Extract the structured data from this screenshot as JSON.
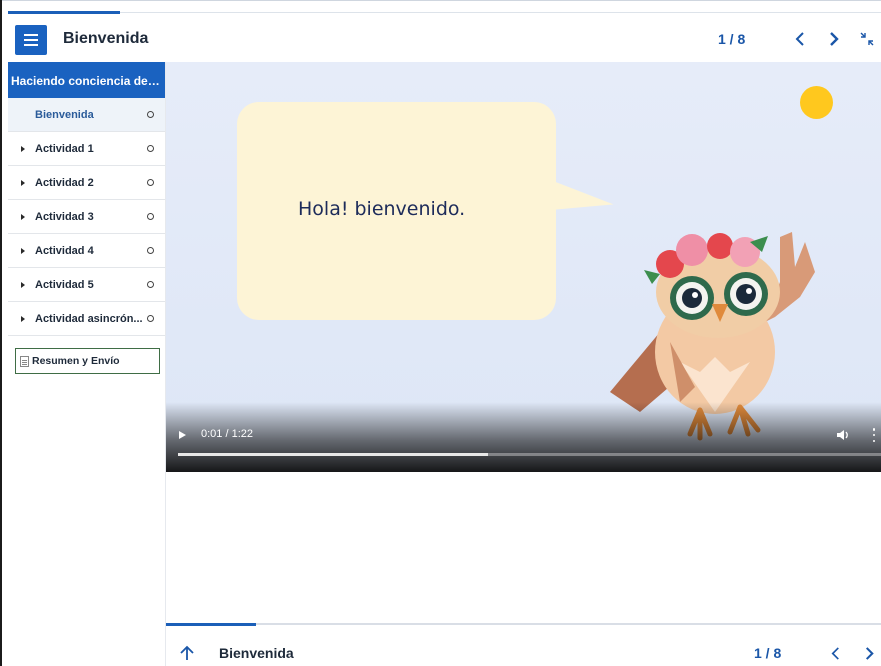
{
  "header": {
    "title": "Bienvenida",
    "page_count": "1 / 8",
    "menu_icon": "hamburger-menu-icon",
    "prev_icon": "chevron-left-icon",
    "next_icon": "chevron-right-icon",
    "collapse_icon": "collapse-arrows-icon"
  },
  "sidebar": {
    "section_title": "Haciendo conciencia de ...",
    "items": [
      {
        "label": "Bienvenida",
        "active": true,
        "expandable": false
      },
      {
        "label": "Actividad 1",
        "active": false,
        "expandable": true
      },
      {
        "label": "Actividad 2",
        "active": false,
        "expandable": true
      },
      {
        "label": "Actividad 3",
        "active": false,
        "expandable": true
      },
      {
        "label": "Actividad 4",
        "active": false,
        "expandable": true
      },
      {
        "label": "Actividad 5",
        "active": false,
        "expandable": true
      },
      {
        "label": "Actividad asincrón...",
        "active": false,
        "expandable": true
      }
    ],
    "summary_label": "Resumen y Envío"
  },
  "video": {
    "speech_text": "Hola! bienvenido.",
    "time": "0:01 / 1:22",
    "progress": 0.44,
    "colors": {
      "bubble": "#fdf4d6",
      "sun": "#ffc81e",
      "background": "#e6ecf9"
    }
  },
  "footer": {
    "title": "Bienvenida",
    "page_count": "1 / 8",
    "up_icon": "arrow-up-icon"
  },
  "colors": {
    "accent": "#1a62c0",
    "summary_border": "#3f6d45"
  }
}
